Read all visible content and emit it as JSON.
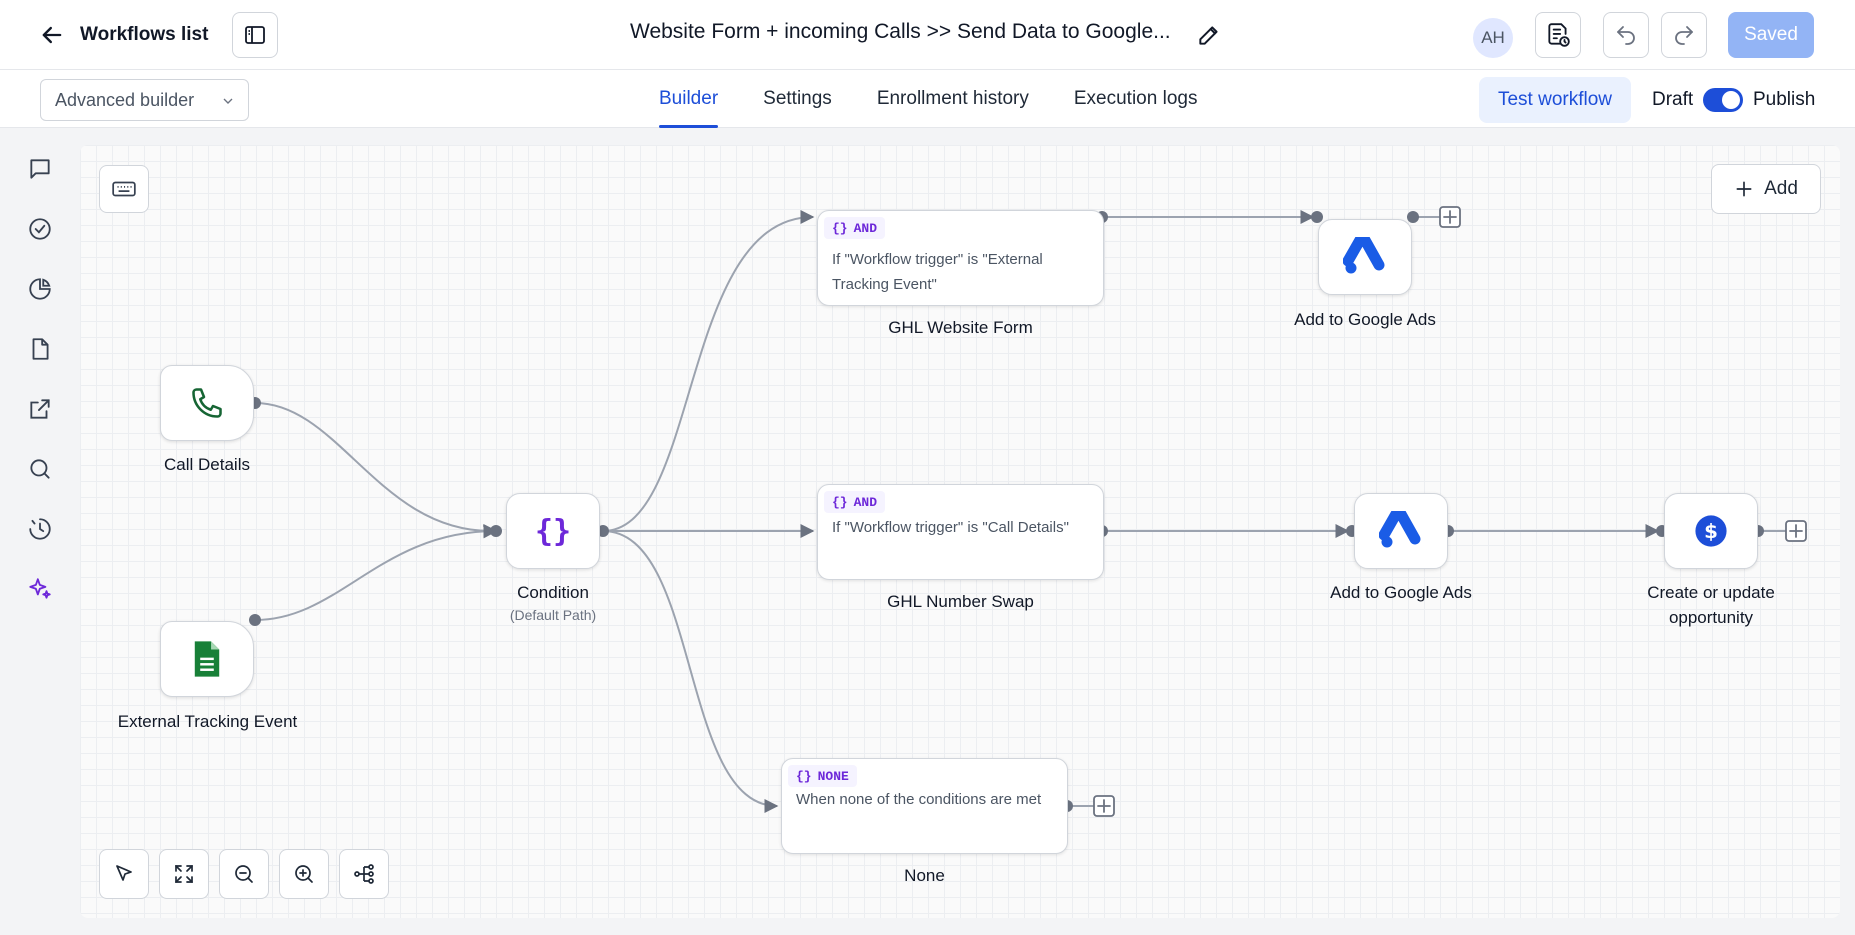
{
  "header": {
    "back_label": "Workflows list",
    "title": "Website Form + incoming Calls >> Send Data to Google...",
    "avatar_initials": "AH",
    "saved_label": "Saved"
  },
  "subbar": {
    "builder_mode": "Advanced builder",
    "tabs": [
      {
        "label": "Builder",
        "active": true
      },
      {
        "label": "Settings",
        "active": false
      },
      {
        "label": "Enrollment history",
        "active": false
      },
      {
        "label": "Execution logs",
        "active": false
      }
    ],
    "test_label": "Test workflow",
    "draft_label": "Draft",
    "publish_label": "Publish",
    "publish_toggle_on": true
  },
  "canvas": {
    "add_label": "Add",
    "triggers": [
      {
        "label": "Call Details",
        "icon": "phone-icon"
      },
      {
        "label": "External Tracking Event",
        "icon": "document-icon"
      }
    ],
    "condition": {
      "label": "Condition",
      "sub_label": "(Default Path)"
    },
    "branches": [
      {
        "tag": "AND",
        "text": "If \"Workflow trigger\" is \"External Tracking Event\"",
        "label": "GHL Website Form"
      },
      {
        "tag": "AND",
        "text": "If \"Workflow trigger\" is \"Call Details\"",
        "label": "GHL Number Swap"
      },
      {
        "tag": "NONE",
        "text": "When none of the conditions are met",
        "label": "None"
      }
    ],
    "actions": [
      {
        "label": "Add to Google Ads",
        "icon": "google-ads-icon"
      },
      {
        "label": "Add to Google Ads",
        "icon": "google-ads-icon"
      },
      {
        "label_line1": "Create or update",
        "label_line2": "opportunity",
        "icon": "dollar-icon"
      }
    ]
  },
  "colors": {
    "accent": "#1d4ed8",
    "condition": "#6d28d9",
    "google_ads": "#1a5ce6",
    "sheets_green": "#188038",
    "phone_green": "#166534"
  }
}
